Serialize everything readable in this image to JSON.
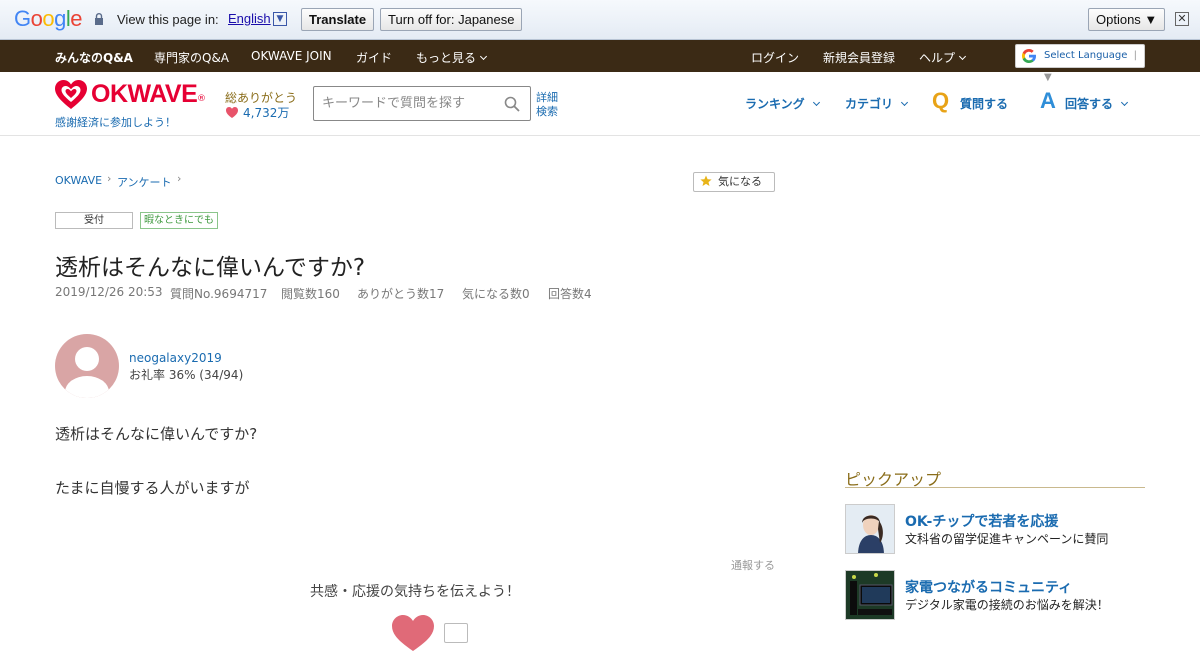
{
  "translate_bar": {
    "logo": "Google",
    "view_in": "View this page in:",
    "language": "English",
    "translate_button": "Translate",
    "turn_off_button": "Turn off for: Japanese",
    "options_button": "Options ▼",
    "close": "✕"
  },
  "top_nav": {
    "items": [
      "みんなのQ&A",
      "専門家のQ&A",
      "OKWAVE JOIN",
      "ガイド",
      "もっと見る"
    ],
    "right_items": [
      "ログイン",
      "新規会員登録",
      "ヘルプ"
    ],
    "select_language": "Select Language"
  },
  "header": {
    "logo_text": "OKWAVE",
    "tagline": "感謝経済に参加しよう！",
    "thanks_label": "総ありがとう",
    "thanks_count": "4,732万",
    "search_placeholder": "キーワードで質問を探す",
    "advanced_search": "詳細検索",
    "nav": [
      "ランキング",
      "カテゴリ"
    ],
    "ask_label": "質問する",
    "answer_label": "回答する",
    "q_letter": "Q",
    "a_letter": "A"
  },
  "breadcrumb": [
    "OKWAVE",
    "アンケート"
  ],
  "watch_button": "気になる",
  "badges": {
    "status": "受付",
    "category": "暇なときにでも"
  },
  "question": {
    "title": "透析はそんなに偉いんですか?",
    "date": "2019/12/26 20:53",
    "question_no": "質問No.9694717",
    "views": "閲覧数160",
    "thanks": "ありがとう数17",
    "watchers": "気になる数0",
    "answers": "回答数4",
    "user_name": "neogalaxy2019",
    "user_rate": "お礼率 36%  (34/94)",
    "body_line1": "透析はそんなに偉いんですか?",
    "body_line2": "たまに自慢する人がいますが",
    "report": "通報する",
    "support_prompt": "共感・応援の気持ちを伝えよう！"
  },
  "pickup": {
    "title": "ピックアップ",
    "items": [
      {
        "heading": "OK-チップで若者を応援",
        "sub": "文科省の留学促進キャンペーンに賛同"
      },
      {
        "heading": "家電つながるコミュニティ",
        "sub": "デジタル家電の接続のお悩みを解決！"
      }
    ]
  },
  "colors": {
    "brand_red": "#e60033",
    "link_blue": "#1a6bb0",
    "nav_brown": "#3b2a15",
    "gold": "#8a6d1a"
  }
}
